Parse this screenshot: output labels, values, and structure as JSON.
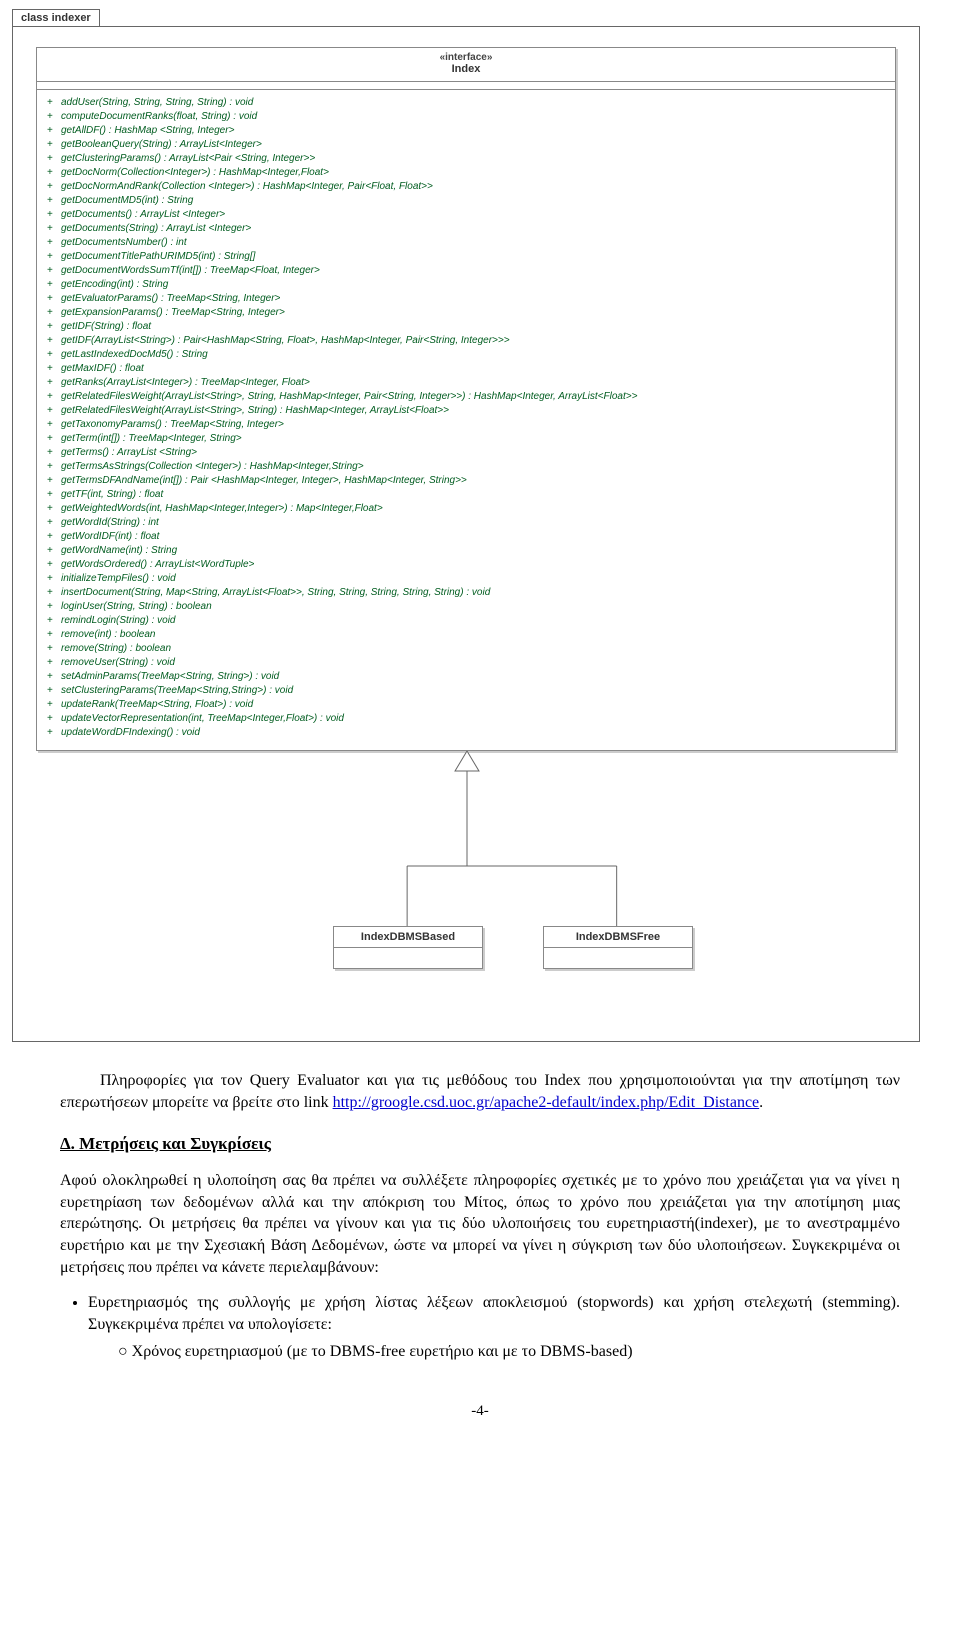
{
  "package": {
    "name": "class indexer"
  },
  "interface": {
    "stereotype": "«interface»",
    "name": "Index",
    "operations": [
      "addUser(String, String, String, String) : void",
      "computeDocumentRanks(float, String) : void",
      "getAllDF() : HashMap <String, Integer>",
      "getBooleanQuery(String) : ArrayList<Integer>",
      "getClusteringParams() : ArrayList<Pair <String, Integer>>",
      "getDocNorm(Collection<Integer>) : HashMap<Integer,Float>",
      "getDocNormAndRank(Collection <Integer>) : HashMap<Integer, Pair<Float, Float>>",
      "getDocumentMD5(int) : String",
      "getDocuments() : ArrayList <Integer>",
      "getDocuments(String) : ArrayList <Integer>",
      "getDocumentsNumber() : int",
      "getDocumentTitlePathURIMD5(int) : String[]",
      "getDocumentWordsSumTf(int[]) : TreeMap<Float, Integer>",
      "getEncoding(int) : String",
      "getEvaluatorParams() : TreeMap<String, Integer>",
      "getExpansionParams() : TreeMap<String, Integer>",
      "getIDF(String) : float",
      "getIDF(ArrayList<String>) : Pair<HashMap<String, Float>, HashMap<Integer, Pair<String, Integer>>>",
      "getLastIndexedDocMd5() : String",
      "getMaxIDF() : float",
      "getRanks(ArrayList<Integer>) : TreeMap<Integer, Float>",
      "getRelatedFilesWeight(ArrayList<String>, String, HashMap<Integer, Pair<String, Integer>>) : HashMap<Integer, ArrayList<Float>>",
      "getRelatedFilesWeight(ArrayList<String>, String) : HashMap<Integer, ArrayList<Float>>",
      "getTaxonomyParams() : TreeMap<String, Integer>",
      "getTerm(int[]) : TreeMap<Integer, String>",
      "getTerms() : ArrayList <String>",
      "getTermsAsStrings(Collection <Integer>) : HashMap<Integer,String>",
      "getTermsDFAndName(int[]) : Pair <HashMap<Integer, Integer>, HashMap<Integer, String>>",
      "getTF(int, String) : float",
      "getWeightedWords(int, HashMap<Integer,Integer>) : Map<Integer,Float>",
      "getWordId(String) : int",
      "getWordIDF(int) : float",
      "getWordName(int) : String",
      "getWordsOrdered() : ArrayList<WordTuple>",
      "initializeTempFiles() : void",
      "insertDocument(String, Map<String, ArrayList<Float>>, String, String, String, String, String) : void",
      "loginUser(String, String) : boolean",
      "remindLogin(String) : void",
      "remove(int) : boolean",
      "remove(String) : boolean",
      "removeUser(String) : void",
      "setAdminParams(TreeMap<String, String>) : void",
      "setClusteringParams(TreeMap<String,String>) : void",
      "updateRank(TreeMap<String, Float>) : void",
      "updateVectorRepresentation(int, TreeMap<Integer,Float>) : void",
      "updateWordDFIndexing() : void"
    ]
  },
  "subclasses": {
    "left": "IndexDBMSBased",
    "right": "IndexDBMSFree"
  },
  "text": {
    "para1_a": "Πληροφορίες για τον Query Evaluator και για τις μεθόδους του Index που χρησιμοποιούνται για την αποτίμηση των επερωτήσεων μπορείτε να βρείτε στο link ",
    "link": "http://groogle.csd.uoc.gr/apache2-default/index.php/Edit_Distance",
    "section_d": "Δ. Μετρήσεις και Συγκρίσεις",
    "para2": "Αφού ολοκληρωθεί η υλοποίηση σας θα πρέπει να συλλέξετε πληροφορίες σχετικές με το χρόνο που χρειάζεται για να γίνει η ευρετηρίαση των δεδομένων αλλά και την απόκριση του Μίτος, όπως το χρόνο που χρειάζεται για την αποτίμηση μιας επερώτησης. Οι μετρήσεις θα πρέπει να γίνουν και για τις δύο υλοποιήσεις του ευρετηριαστή(indexer), με το ανεστραμμένο ευρετήριο και με την Σχεσιακή Βάση Δεδομένων, ώστε να μπορεί να γίνει η σύγκριση των δύο υλοποιήσεων.  Συγκεκριμένα οι μετρήσεις που πρέπει να κάνετε περιελαμβάνουν:",
    "bullet1": "Ευρετηριασμός της συλλογής με χρήση λίστας λέξεων αποκλεισμού (stopwords) και χρήση στελεχωτή (stemming). Συγκεκριμένα πρέπει να υπολογίσετε:",
    "sub1": "Χρόνος ευρετηριασμού (με το DBMS-free ευρετήριο και με το DBMS-based)",
    "pagenum": "-4-",
    "period": "."
  }
}
